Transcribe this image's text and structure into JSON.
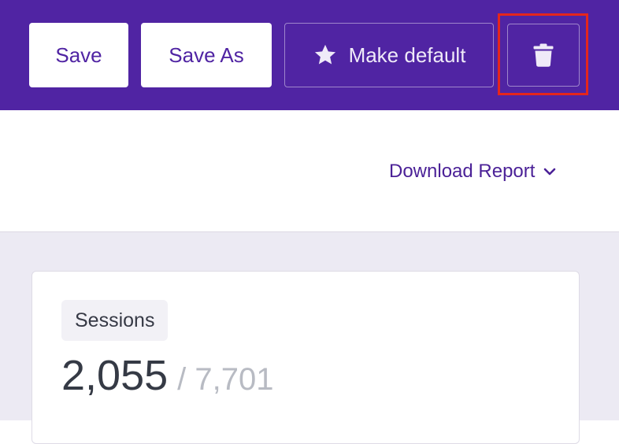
{
  "header": {
    "save_label": "Save",
    "save_as_label": "Save As",
    "make_default_label": "Make default",
    "delete_icon": "trash-icon",
    "star_icon": "star-icon",
    "highlight_color": "#e5261c",
    "background_color": "#5024a3"
  },
  "toolbar": {
    "download_label": "Download Report",
    "download_icon": "chevron-down-icon"
  },
  "metric_card": {
    "label": "Sessions",
    "value": "2,055",
    "total": "/ 7,701"
  }
}
